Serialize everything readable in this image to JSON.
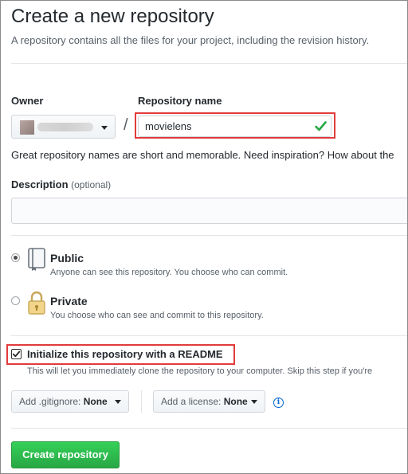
{
  "header": {
    "title": "Create a new repository",
    "subtitle": "A repository contains all the files for your project, including the revision history."
  },
  "owner": {
    "label": "Owner"
  },
  "repo_name": {
    "label": "Repository name",
    "separator": "/",
    "value": "movielens",
    "valid": true
  },
  "help_text": "Great repository names are short and memorable. Need inspiration? How about the",
  "description": {
    "label": "Description",
    "optional": "(optional)",
    "value": ""
  },
  "visibility": {
    "selected": "public",
    "options": [
      {
        "key": "public",
        "title": "Public",
        "desc": "Anyone can see this repository. You choose who can commit.",
        "icon": "book-icon"
      },
      {
        "key": "private",
        "title": "Private",
        "desc": "You choose who can see and commit to this repository.",
        "icon": "lock-icon"
      }
    ]
  },
  "readme": {
    "checked": true,
    "label": "Initialize this repository with a README",
    "desc": "This will let you immediately clone the repository to your computer. Skip this step if you're"
  },
  "gitignore": {
    "prefix": "Add .gitignore:",
    "value": "None"
  },
  "license": {
    "prefix": "Add a license:",
    "value": "None"
  },
  "submit_label": "Create repository",
  "colors": {
    "accent_green": "#28a745",
    "highlight_red": "#e23b3b",
    "link_blue": "#0366d6"
  }
}
